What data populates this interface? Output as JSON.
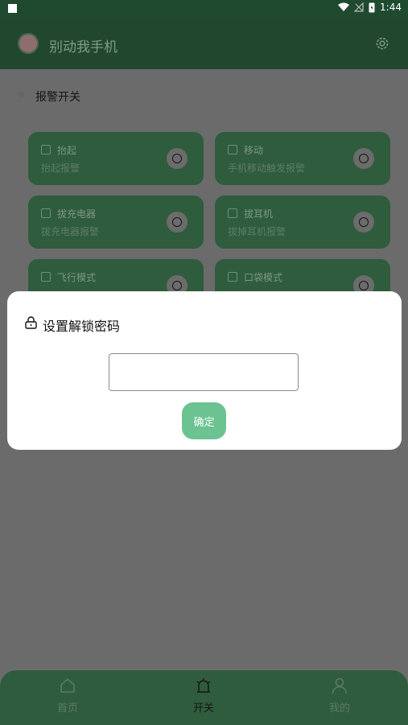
{
  "status": {
    "time": "1:44"
  },
  "app": {
    "title": "别动我手机"
  },
  "section": {
    "title": "报警开关"
  },
  "cards": [
    {
      "name": "抬起",
      "desc": "抬起报警"
    },
    {
      "name": "移动",
      "desc": "手机移动触发报警"
    },
    {
      "name": "拔充电器",
      "desc": "拔充电器报警"
    },
    {
      "name": "拔耳机",
      "desc": "拔掉耳机报警"
    },
    {
      "name": "飞行模式",
      "desc": ""
    },
    {
      "name": "口袋模式",
      "desc": ""
    }
  ],
  "dialog": {
    "title": "设置解锁密码",
    "input_value": "",
    "confirm_label": "确定"
  },
  "nav": {
    "home": "首页",
    "switch": "开关",
    "mine": "我的"
  },
  "colors": {
    "accent": "#6cc391",
    "card": "#2f5c3d"
  }
}
